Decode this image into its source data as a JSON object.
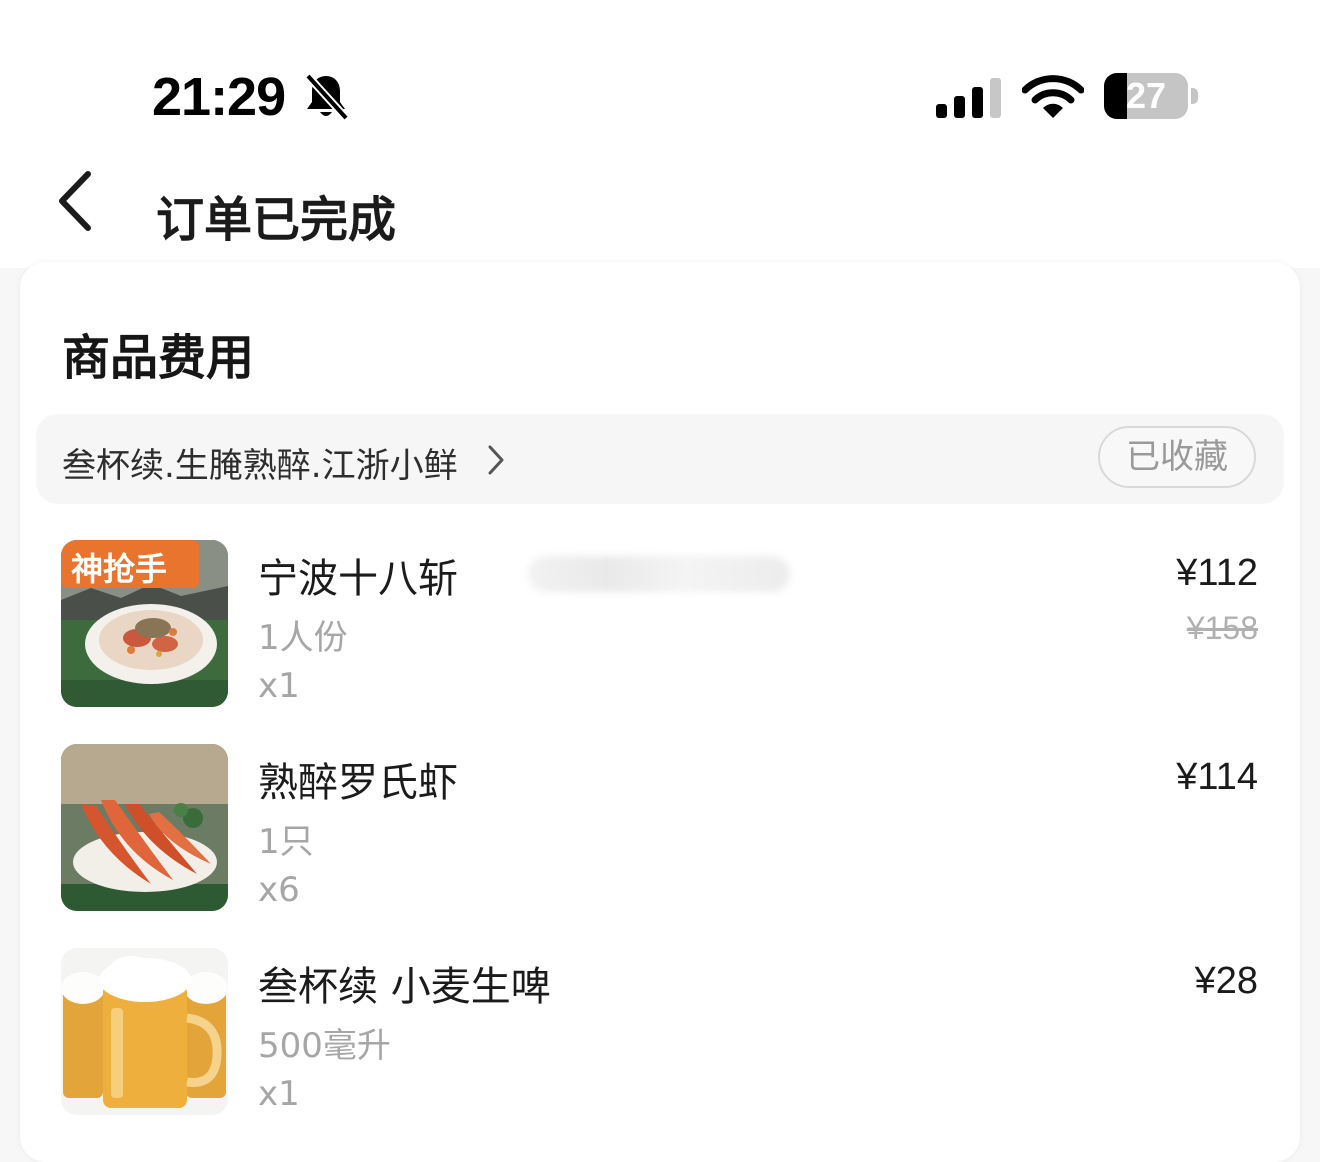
{
  "status_bar": {
    "time": "21:29",
    "battery_text": "27",
    "battery_level": 0.27,
    "mute_icon": "bell-slash-icon",
    "signal_icon": "cellular-signal-icon",
    "wifi_icon": "wifi-icon"
  },
  "header": {
    "back_icon": "chevron-left-icon",
    "title": "订单已完成"
  },
  "section": {
    "title": "商品费用"
  },
  "store": {
    "name": "叁杯续.生腌熟醉.江浙小鲜",
    "arrow_icon": "chevron-right-icon",
    "favorite_label": "已收藏"
  },
  "items": [
    {
      "name": "宁波十八斩",
      "spec": "1人份",
      "qty": "x1",
      "price": "¥112",
      "original_price": "¥158",
      "badge": "神抢手",
      "thumb_icon": "seafood-dish-photo"
    },
    {
      "name": "熟醉罗氏虾",
      "spec": "1只",
      "qty": "x6",
      "price": "¥114",
      "thumb_icon": "shrimp-dish-photo"
    },
    {
      "name": "叁杯续 小麦生啤",
      "spec": "500毫升",
      "qty": "x1",
      "price": "¥28",
      "thumb_icon": "beer-mug-photo"
    }
  ],
  "colors": {
    "background": "#f7f7f7",
    "card": "#ffffff",
    "badge": "#e8742e",
    "muted_text": "#a6a6a6"
  }
}
